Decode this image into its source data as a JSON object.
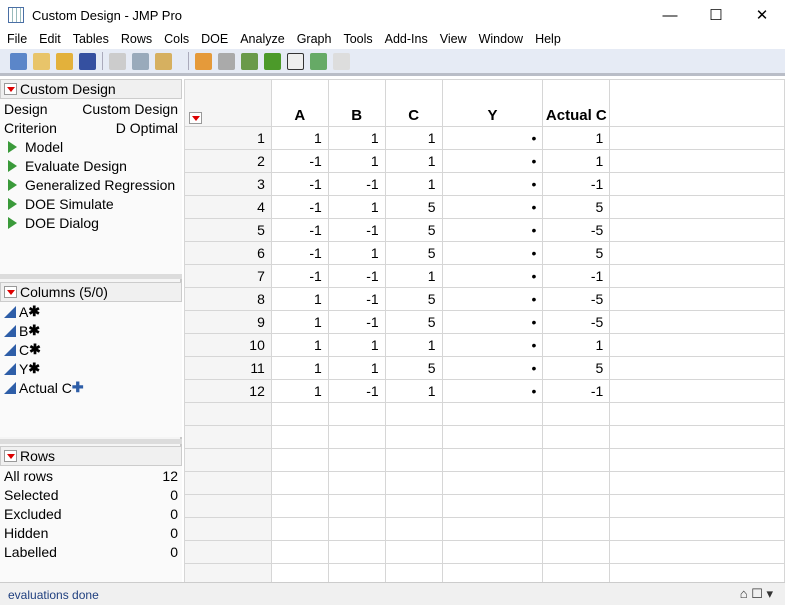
{
  "window": {
    "title": "Custom Design - JMP Pro"
  },
  "menu": [
    "File",
    "Edit",
    "Tables",
    "Rows",
    "Cols",
    "DOE",
    "Analyze",
    "Graph",
    "Tools",
    "Add-Ins",
    "View",
    "Window",
    "Help"
  ],
  "design_panel": {
    "title": "Custom Design",
    "design_label": "Design",
    "design_value": "Custom Design",
    "criterion_label": "Criterion",
    "criterion_value": "D Optimal",
    "scripts": [
      "Model",
      "Evaluate Design",
      "Generalized Regression",
      "DOE Simulate",
      "DOE Dialog"
    ]
  },
  "columns_panel": {
    "title": "Columns (5/0)",
    "items": [
      {
        "name": "A",
        "mark": "✱"
      },
      {
        "name": "B",
        "mark": "✱"
      },
      {
        "name": "C",
        "mark": "✱"
      },
      {
        "name": "Y",
        "mark": "✱"
      },
      {
        "name": "Actual C",
        "mark": "✚"
      }
    ]
  },
  "rows_panel": {
    "title": "Rows",
    "items": [
      {
        "label": "All rows",
        "value": "12"
      },
      {
        "label": "Selected",
        "value": "0"
      },
      {
        "label": "Excluded",
        "value": "0"
      },
      {
        "label": "Hidden",
        "value": "0"
      },
      {
        "label": "Labelled",
        "value": "0"
      }
    ]
  },
  "table": {
    "headers": [
      "A",
      "B",
      "C",
      "Y",
      "Actual C"
    ],
    "rows": [
      [
        "1",
        "1",
        "1",
        "1",
        "•",
        "1"
      ],
      [
        "2",
        "-1",
        "1",
        "1",
        "•",
        "1"
      ],
      [
        "3",
        "-1",
        "-1",
        "1",
        "•",
        "-1"
      ],
      [
        "4",
        "-1",
        "1",
        "5",
        "•",
        "5"
      ],
      [
        "5",
        "-1",
        "-1",
        "5",
        "•",
        "-5"
      ],
      [
        "6",
        "-1",
        "1",
        "5",
        "•",
        "5"
      ],
      [
        "7",
        "-1",
        "-1",
        "1",
        "•",
        "-1"
      ],
      [
        "8",
        "1",
        "-1",
        "5",
        "•",
        "-5"
      ],
      [
        "9",
        "1",
        "-1",
        "5",
        "•",
        "-5"
      ],
      [
        "10",
        "1",
        "1",
        "1",
        "•",
        "1"
      ],
      [
        "11",
        "1",
        "1",
        "5",
        "•",
        "5"
      ],
      [
        "12",
        "1",
        "-1",
        "1",
        "•",
        "-1"
      ]
    ]
  },
  "status": {
    "text": "evaluations done"
  }
}
